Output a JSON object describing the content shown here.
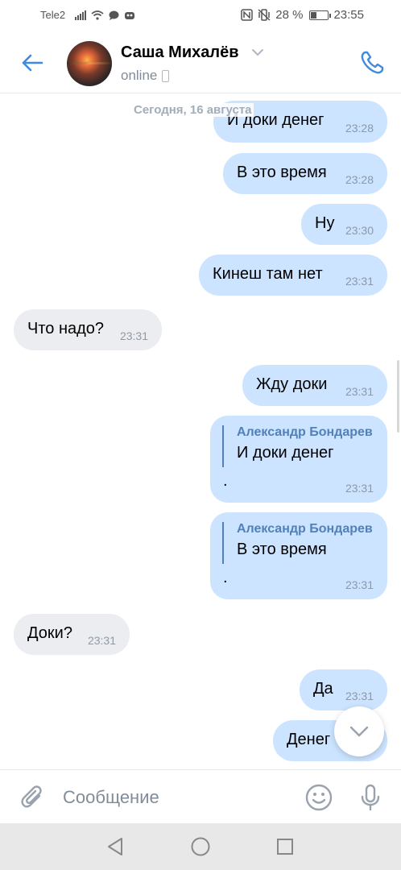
{
  "status_bar": {
    "carrier": "Tele2",
    "battery_percent": "28 %",
    "battery_level": 0.28,
    "time": "23:55"
  },
  "header": {
    "contact_name": "Саша Михалёв",
    "status": "online"
  },
  "chat": {
    "date_separator": "Сегодня, 16 августа",
    "messages": [
      {
        "direction": "out",
        "text": "И доки денег",
        "time": "23:28"
      },
      {
        "direction": "out",
        "text": "В это время",
        "time": "23:28"
      },
      {
        "direction": "out",
        "text": "Ну",
        "time": "23:30"
      },
      {
        "direction": "out",
        "text": "Кинеш там нет",
        "time": "23:31"
      },
      {
        "direction": "in",
        "text": "Что надо?",
        "time": "23:31"
      },
      {
        "direction": "out",
        "text": "Жду доки",
        "time": "23:31"
      },
      {
        "direction": "out",
        "reply_author": "Александр Бондарев",
        "reply_text": "И доки денег",
        "text": ".",
        "time": "23:31"
      },
      {
        "direction": "out",
        "reply_author": "Александр Бондарев",
        "reply_text": "В это время",
        "text": ".",
        "time": "23:31"
      },
      {
        "direction": "in",
        "text": "Доки?",
        "time": "23:31"
      },
      {
        "direction": "out",
        "text": "Да",
        "time": "23:31"
      },
      {
        "direction": "out",
        "text": "Денег",
        "time": ""
      }
    ]
  },
  "composer": {
    "placeholder": "Сообщение"
  },
  "colors": {
    "accent": "#3f8ae0",
    "outgoing_bubble": "#cce4ff",
    "incoming_bubble": "#ebedf0",
    "reply_accent": "#5181b8"
  }
}
